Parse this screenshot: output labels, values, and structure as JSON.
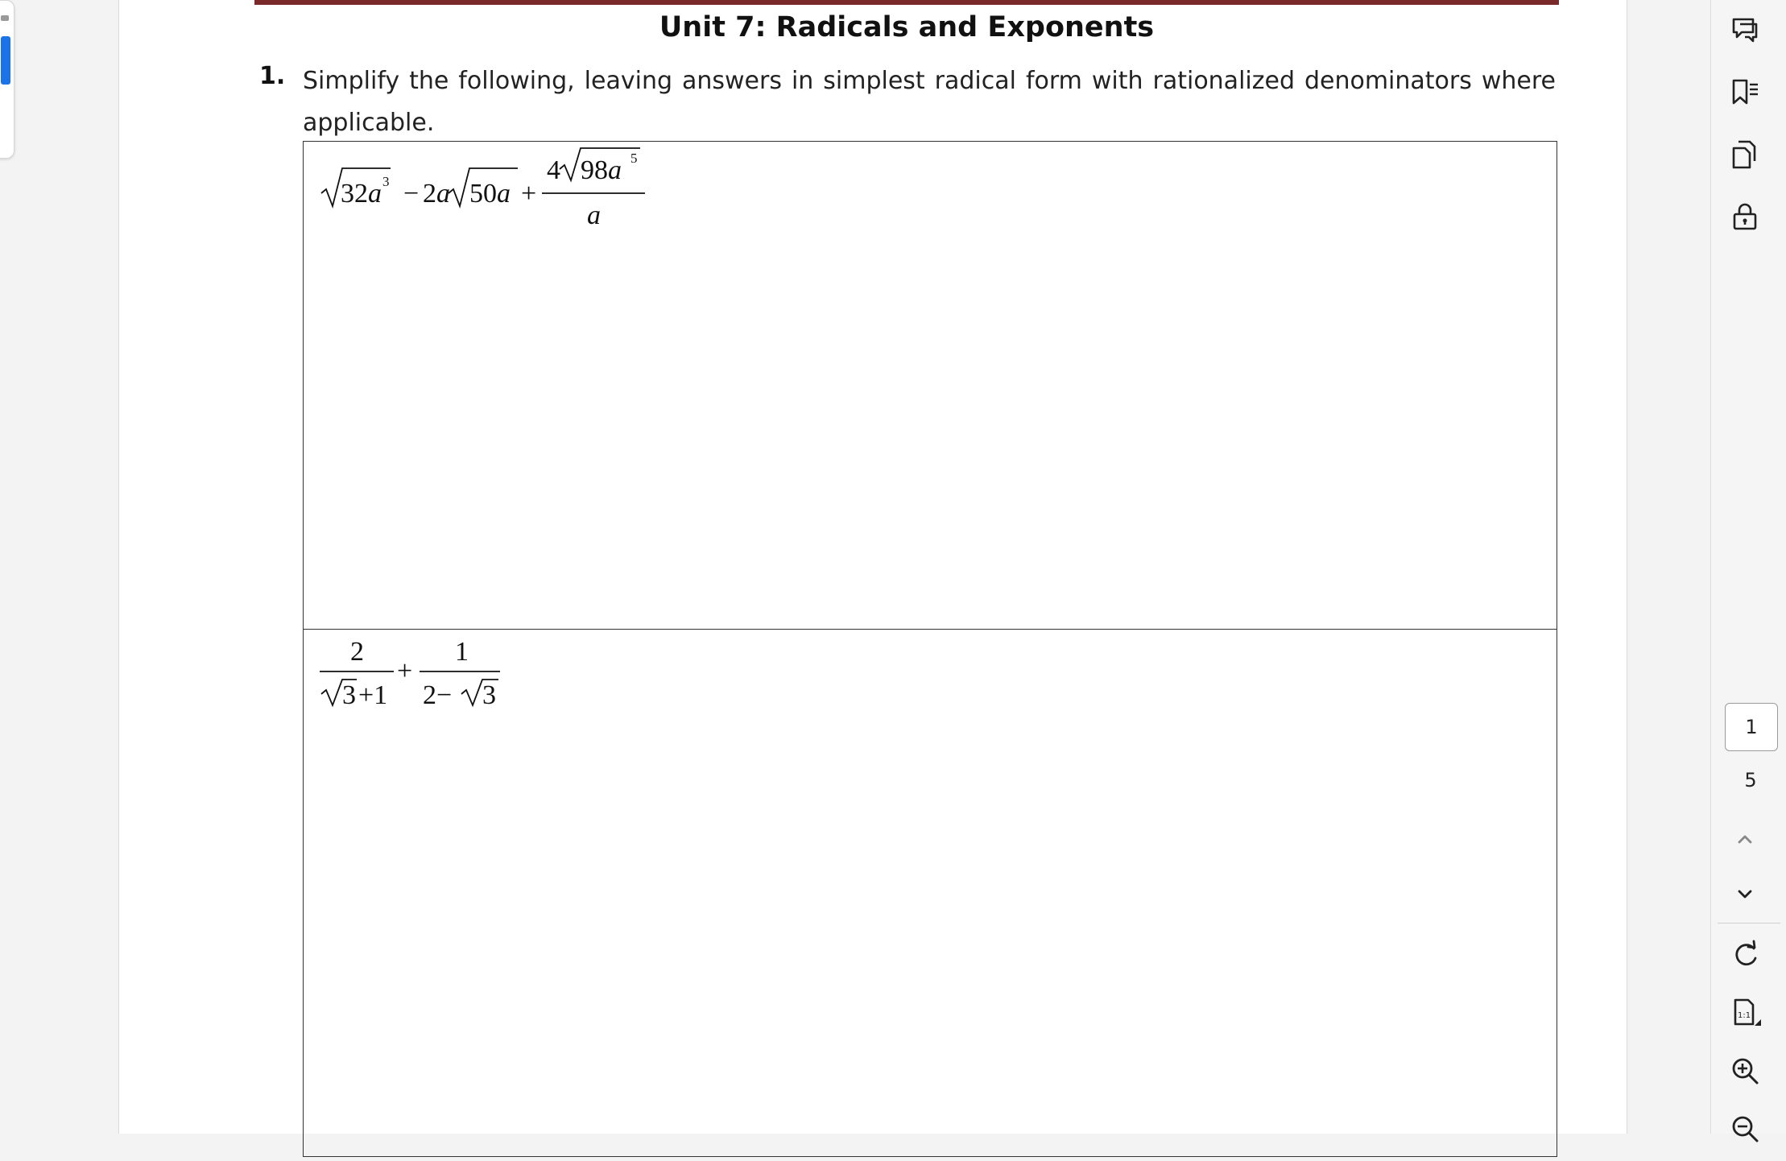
{
  "document": {
    "title": "Unit 7: Radicals and Exponents",
    "question_number": "1.",
    "question_text": "Simplify the following, leaving answers in simplest radical form with rationalized denominators where applicable.",
    "problems": [
      {
        "expression": "√(32a³) − 2a√(50a) + 4√(98a⁵)/a",
        "parts": {
          "rad1": "32",
          "var1": "a",
          "exp1": "3",
          "minus": "−",
          "coef2": "2",
          "var2": "a",
          "rad2": "50",
          "var3": "a",
          "plus": "+",
          "num_coef": "4",
          "num_rad": "98",
          "num_var": "a",
          "num_exp": "5",
          "denominator": "a"
        }
      },
      {
        "expression": "2/(√3+1) + 1/(2−√3)",
        "parts": {
          "num1": "2",
          "den1_rad": "3",
          "den1_rest": "+1",
          "plus": "+",
          "num2": "1",
          "den2_lead": "2−",
          "den2_rad": "3"
        }
      }
    ]
  },
  "toolbar": {
    "icons": [
      "comment-icon",
      "bookmark-list-icon",
      "copy-icon",
      "lock-icon",
      "rotate-icon",
      "actual-size-icon",
      "zoom-in-icon",
      "zoom-out-icon",
      "chevron-up-icon",
      "chevron-down-icon"
    ],
    "current_page": "1",
    "total_pages": "5"
  }
}
